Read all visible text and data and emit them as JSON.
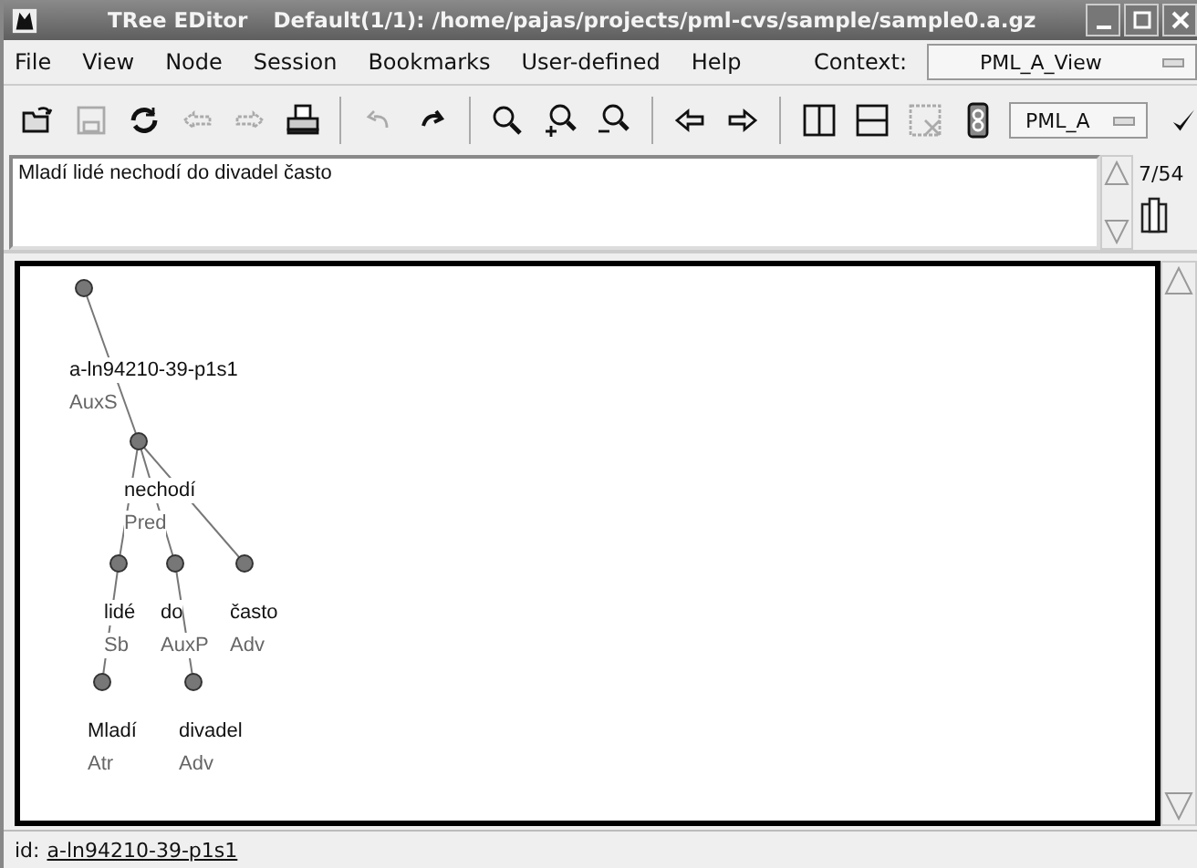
{
  "window": {
    "title": "TRee EDitor",
    "document": "Default(1/1): /home/pajas/projects/pml-cvs/sample/sample0.a.gz"
  },
  "menu": [
    {
      "label": "File"
    },
    {
      "label": "View"
    },
    {
      "label": "Node"
    },
    {
      "label": "Session"
    },
    {
      "label": "Bookmarks"
    },
    {
      "label": "User-defined"
    },
    {
      "label": "Help"
    }
  ],
  "context": {
    "label": "Context:",
    "value": "PML_A_View"
  },
  "toolbar": [
    {
      "kind": "open",
      "disabled": false
    },
    {
      "kind": "save",
      "disabled": true
    },
    {
      "kind": "reload",
      "disabled": false
    },
    {
      "kind": "prev-file",
      "disabled": true
    },
    {
      "kind": "next-file",
      "disabled": true
    },
    {
      "kind": "print",
      "disabled": false
    },
    {
      "kind": "sep"
    },
    {
      "kind": "undo",
      "disabled": true
    },
    {
      "kind": "redo",
      "disabled": false
    },
    {
      "kind": "sep"
    },
    {
      "kind": "search",
      "disabled": false
    },
    {
      "kind": "zoom-in",
      "disabled": false
    },
    {
      "kind": "zoom-out",
      "disabled": false
    },
    {
      "kind": "sep"
    },
    {
      "kind": "prev-tree",
      "disabled": false
    },
    {
      "kind": "next-tree",
      "disabled": false
    },
    {
      "kind": "sep"
    },
    {
      "kind": "split-v",
      "disabled": false
    },
    {
      "kind": "split-h",
      "disabled": false
    },
    {
      "kind": "close-view",
      "disabled": true
    },
    {
      "kind": "link",
      "disabled": false
    }
  ],
  "layer": {
    "value": "PML_A"
  },
  "sentence": {
    "text": "Mladí lidé nechodí do divadel často",
    "position": "7/54"
  },
  "tree": {
    "form": "a-ln94210-39-p1s1",
    "afun": "AuxS",
    "children": [
      {
        "form": "nechodí",
        "afun": "Pred",
        "children": [
          {
            "form": "lidé",
            "afun": "Sb",
            "children": [
              {
                "form": "Mladí",
                "afun": "Atr"
              }
            ]
          },
          {
            "form": "do",
            "afun": "AuxP",
            "children": [
              {
                "form": "divadel",
                "afun": "Adv"
              }
            ]
          },
          {
            "form": "často",
            "afun": "Adv"
          }
        ]
      }
    ]
  },
  "status_bar": {
    "label": "id:",
    "link": "a-ln94210-39-p1s1"
  }
}
